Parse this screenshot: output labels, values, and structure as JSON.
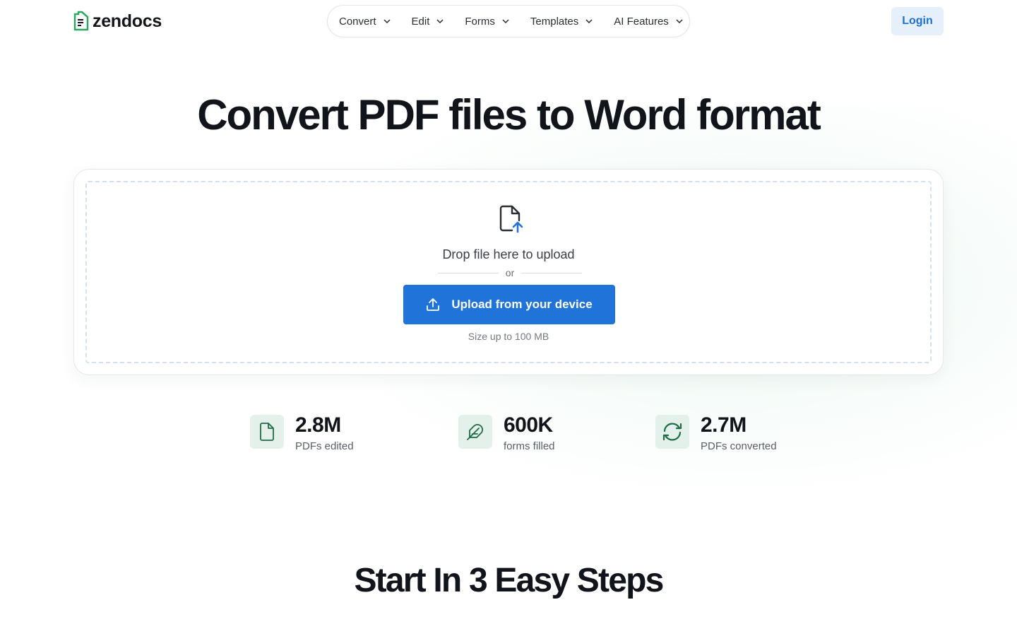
{
  "brand": {
    "name": "zendocs",
    "accent": "#1f73d9",
    "logo_color": "#2aa85f"
  },
  "nav": {
    "items": [
      {
        "label": "Convert"
      },
      {
        "label": "Edit"
      },
      {
        "label": "Forms"
      },
      {
        "label": "Templates"
      },
      {
        "label": "AI Features"
      }
    ],
    "login_label": "Login"
  },
  "hero": {
    "title": "Convert PDF files to Word format"
  },
  "upload": {
    "icon": "file-upload-icon",
    "drop_text": "Drop file here to upload",
    "or_text": "or",
    "button_label": "Upload from your device",
    "size_note": "Size up to 100 MB"
  },
  "stats": [
    {
      "value": "2.8M",
      "label": "PDFs edited",
      "icon": "document-icon"
    },
    {
      "value": "600K",
      "label": "forms filled",
      "icon": "feather-icon"
    },
    {
      "value": "2.7M",
      "label": "PDFs converted",
      "icon": "refresh-icon"
    }
  ],
  "steps": {
    "title": "Start In 3 Easy Steps"
  }
}
